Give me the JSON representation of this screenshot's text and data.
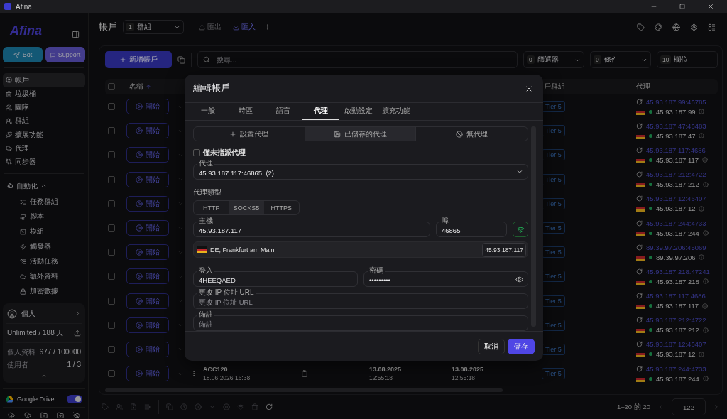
{
  "window": {
    "title": "Afina"
  },
  "sidebar": {
    "logo": "Afina",
    "buttons": [
      {
        "kind": "telegram",
        "label": "Bot"
      },
      {
        "kind": "support",
        "label": "Support"
      }
    ],
    "nav": [
      {
        "kind": "user",
        "label": "帳戶",
        "selected": true
      },
      {
        "kind": "trash",
        "label": "垃圾桶",
        "selected": false
      },
      {
        "kind": "team",
        "label": "團隊",
        "selected": false
      },
      {
        "kind": "group",
        "label": "群組",
        "selected": false
      },
      {
        "kind": "extension",
        "label": "擴展功能",
        "selected": false
      },
      {
        "kind": "cloud",
        "label": "代理",
        "selected": false
      },
      {
        "kind": "sync",
        "label": "同步器",
        "selected": false
      }
    ],
    "automation": {
      "label": "自動化",
      "expanded": true,
      "children": [
        {
          "kind": "list",
          "label": "任務群組"
        },
        {
          "kind": "github",
          "label": "腳本"
        },
        {
          "kind": "terminal",
          "label": "模組"
        },
        {
          "kind": "zap",
          "label": "觸發器"
        },
        {
          "kind": "tasks",
          "label": "活動任務"
        },
        {
          "kind": "cloud",
          "label": "額外資料"
        },
        {
          "kind": "lock",
          "label": "加密數據"
        }
      ]
    },
    "profile": {
      "name": "個人",
      "plan": "Unlimited / 188 天",
      "stats": [
        {
          "label": "個人資料",
          "value": "677 / 100000"
        },
        {
          "label": "使用者",
          "value": "1 / 3"
        }
      ]
    },
    "google_drive": {
      "label": "Google Drive",
      "on": true
    }
  },
  "header": {
    "title": "帳戶",
    "group_select": {
      "count": "1",
      "label": "群組"
    },
    "actions": [
      {
        "kind": "export",
        "label": "匯出",
        "disabled": true
      },
      {
        "kind": "import",
        "label": "匯入",
        "disabled": false
      }
    ]
  },
  "toolbar": {
    "add_button": "新增帳戶",
    "search": {
      "placeholder": "搜尋..."
    },
    "filters": [
      {
        "count": "0",
        "label": "篩選器",
        "dropdown": true
      },
      {
        "count": "0",
        "label": "條件",
        "dropdown": true
      },
      {
        "count": "10",
        "label": "欄位",
        "dropdown": false
      }
    ]
  },
  "table": {
    "select_all_checked": false,
    "columns": [
      {
        "label": "名稱",
        "sorted": true
      },
      {
        "label": "戶群組"
      },
      {
        "label": "代理"
      }
    ],
    "rows": [
      {
        "selected": false,
        "start": "開始",
        "tier": "Tier 5",
        "proxy": "45.93.187.99:46785",
        "ip": "45.93.187.99"
      },
      {
        "selected": false,
        "start": "開始",
        "tier": "Tier 5",
        "proxy": "45.93.187.47:46483",
        "ip": "45.93.187.47"
      },
      {
        "selected": false,
        "start": "開始",
        "tier": "Tier 5",
        "proxy": "45.93.187.117:4686",
        "ip": "45.93.187.117"
      },
      {
        "selected": false,
        "start": "開始",
        "tier": "Tier 5",
        "proxy": "45.93.187.212:4722",
        "ip": "45.93.187.212"
      },
      {
        "selected": false,
        "start": "開始",
        "tier": "Tier 5",
        "proxy": "45.93.187.12:46407",
        "ip": "45.93.187.12"
      },
      {
        "selected": false,
        "start": "開始",
        "tier": "Tier 5",
        "proxy": "45.93.187.244:4733",
        "ip": "45.93.187.244"
      },
      {
        "selected": false,
        "start": "開始",
        "tier": "Tier 5",
        "proxy": "89.39.97.206:45069",
        "ip": "89.39.97.206"
      },
      {
        "selected": false,
        "start": "開始",
        "tier": "Tier 5",
        "proxy": "45.93.187.218:47241",
        "ip": "45.93.187.218"
      },
      {
        "selected": false,
        "start": "開始",
        "tier": "Tier 5",
        "proxy": "45.93.187.117:4686",
        "ip": "45.93.187.117"
      },
      {
        "selected": false,
        "start": "開始",
        "tier": "Tier 5",
        "proxy": "45.93.187.212:4722",
        "ip": "45.93.187.212"
      },
      {
        "selected": false,
        "start": "開始",
        "tier": "Tier 5",
        "proxy": "45.93.187.12:46407",
        "ip": "45.93.187.12"
      },
      {
        "selected": false,
        "start": "開始",
        "tier": "Tier 5",
        "proxy": "45.93.187.244:4733",
        "ip": "45.93.187.244",
        "name": "ACC120",
        "created": "18.06.2026 16:38",
        "date_1": "13.08.2025",
        "time_1": "12:55:18",
        "date_2": "13.08.2025",
        "time_2": "12:55:18"
      }
    ]
  },
  "pagination": {
    "range": "1–20 的 20",
    "page": "122"
  },
  "modal": {
    "title": "編輯帳戶",
    "tabs": [
      {
        "label": "一般",
        "selected": false
      },
      {
        "label": "時區",
        "selected": false
      },
      {
        "label": "語言",
        "selected": false
      },
      {
        "label": "代理",
        "selected": true
      },
      {
        "label": "啟動設定",
        "selected": false
      },
      {
        "label": "擴充功能",
        "selected": false
      }
    ],
    "proxy_modes": [
      {
        "kind": "add",
        "label": "設置代理",
        "selected": false
      },
      {
        "kind": "saved",
        "label": "已儲存的代理",
        "selected": true
      },
      {
        "kind": "none",
        "label": "無代理",
        "selected": false
      }
    ],
    "unassigned_only": {
      "label": "僅未指派代理",
      "checked": false
    },
    "proxy_select": {
      "label": "代理",
      "value": "45.93.187.117:46865  (2)"
    },
    "proxy_type": {
      "label": "代理類型",
      "options": [
        {
          "label": "HTTP",
          "selected": false
        },
        {
          "label": "SOCKS5",
          "selected": true
        },
        {
          "label": "HTTPS",
          "selected": false
        }
      ]
    },
    "host": {
      "label": "主機",
      "value": "45.93.187.117"
    },
    "port": {
      "label": "埠",
      "value": "46865"
    },
    "location": {
      "label": "DE, Frankfurt am Main",
      "ip": "45.93.187.117"
    },
    "login": {
      "label": "登入",
      "value": "4HEEQAED"
    },
    "password": {
      "label": "密碼",
      "value": "•••••••••"
    },
    "change_ip_url": {
      "label": "更改 IP 位址 URL",
      "placeholder": "更改 IP 位址 URL"
    },
    "notes": {
      "label": "備註",
      "placeholder": "備註"
    },
    "buttons": [
      {
        "kind": "cancel",
        "label": "取消"
      },
      {
        "kind": "save",
        "label": "儲存"
      }
    ]
  }
}
